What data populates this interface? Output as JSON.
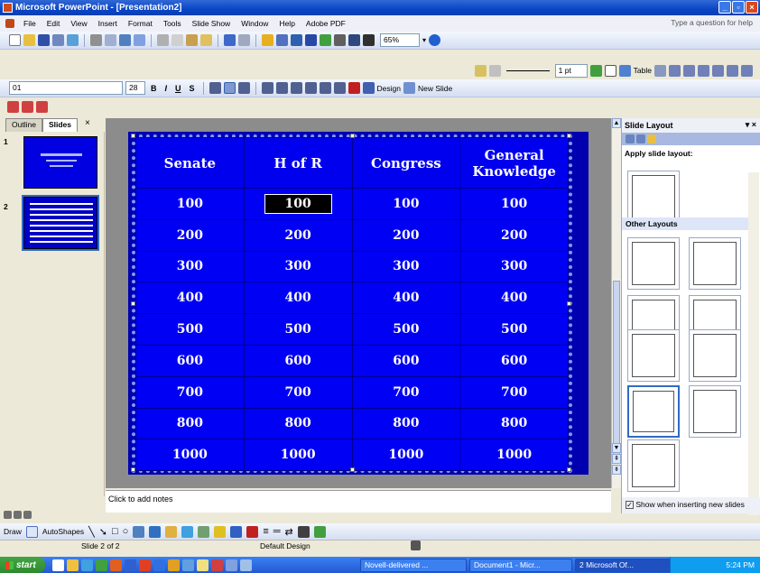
{
  "window": {
    "title": "Microsoft PowerPoint - [Presentation2]"
  },
  "menu": {
    "items": [
      "File",
      "Edit",
      "View",
      "Insert",
      "Format",
      "Tools",
      "Slide Show",
      "Window",
      "Help",
      "Adobe PDF"
    ],
    "help_placeholder": "Type a question for help"
  },
  "toolbar": {
    "zoom": "65%",
    "line_weight": "1 pt",
    "table_label": "Table",
    "font_name": "01",
    "font_size": "28",
    "bold": "B",
    "italic": "I",
    "underline": "U",
    "shadow": "S",
    "design_label": "Design",
    "new_slide_label": "New Slide"
  },
  "panes": {
    "tab_outline": "Outline",
    "tab_slides": "Slides",
    "tab_close": "×",
    "slide_numbers": [
      "1",
      "2"
    ]
  },
  "jeopardy": {
    "headers": [
      "Senate",
      "H of R",
      "Congress",
      "General Knowledge"
    ],
    "values": [
      "100",
      "200",
      "300",
      "400",
      "500",
      "600",
      "700",
      "800",
      "1000"
    ],
    "selected_cell": "100"
  },
  "notes": {
    "placeholder": "Click to add notes"
  },
  "task_pane": {
    "title": "Slide Layout",
    "apply_label": "Apply slide layout:",
    "other_label": "Other Layouts",
    "show_checkbox_label": "Show when inserting new slides"
  },
  "drawbar": {
    "draw_label": "Draw",
    "autoshapes_label": "AutoShapes"
  },
  "status": {
    "slide_info": "Slide 2 of 2",
    "design": "Default Design"
  },
  "taskbar": {
    "start_label": "start",
    "tasks": [
      "Novell-delivered ...",
      "Document1 - Micr...",
      "2 Microsoft Of..."
    ],
    "clock": "5:24 PM"
  }
}
